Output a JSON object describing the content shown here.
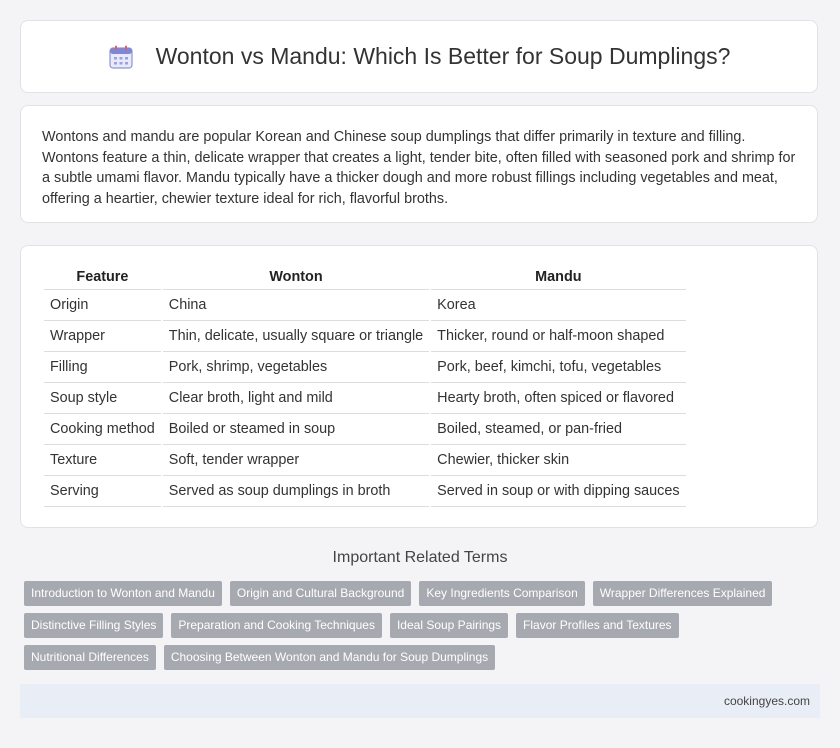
{
  "page": {
    "title": "Wonton vs Mandu: Which Is Better for Soup Dumplings?",
    "title_icon": "calendar-icon",
    "intro": "Wontons and mandu are popular Korean and Chinese soup dumplings that differ primarily in texture and filling. Wontons feature a thin, delicate wrapper that creates a light, tender bite, often filled with seasoned pork and shrimp for a subtle umami flavor. Mandu typically have a thicker dough and more robust fillings including vegetables and meat, offering a heartier, chewier texture ideal for rich, flavorful broths."
  },
  "table": {
    "headers": [
      "Feature",
      "Wonton",
      "Mandu"
    ],
    "rows": [
      [
        "Origin",
        "China",
        "Korea"
      ],
      [
        "Wrapper",
        "Thin, delicate, usually square or triangle",
        "Thicker, round or half-moon shaped"
      ],
      [
        "Filling",
        "Pork, shrimp, vegetables",
        "Pork, beef, kimchi, tofu, vegetables"
      ],
      [
        "Soup style",
        "Clear broth, light and mild",
        "Hearty broth, often spiced or flavored"
      ],
      [
        "Cooking method",
        "Boiled or steamed in soup",
        "Boiled, steamed, or pan-fried"
      ],
      [
        "Texture",
        "Soft, tender wrapper",
        "Chewier, thicker skin"
      ],
      [
        "Serving",
        "Served as soup dumplings in broth",
        "Served in soup or with dipping sauces"
      ]
    ]
  },
  "related": {
    "title": "Important Related Terms",
    "tags": [
      "Introduction to Wonton and Mandu",
      "Origin and Cultural Background",
      "Key Ingredients Comparison",
      "Wrapper Differences Explained",
      "Distinctive Filling Styles",
      "Preparation and Cooking Techniques",
      "Ideal Soup Pairings",
      "Flavor Profiles and Textures",
      "Nutritional Differences",
      "Choosing Between Wonton and Mandu for Soup Dumplings"
    ]
  },
  "footer": {
    "site": "cookingyes.com"
  }
}
